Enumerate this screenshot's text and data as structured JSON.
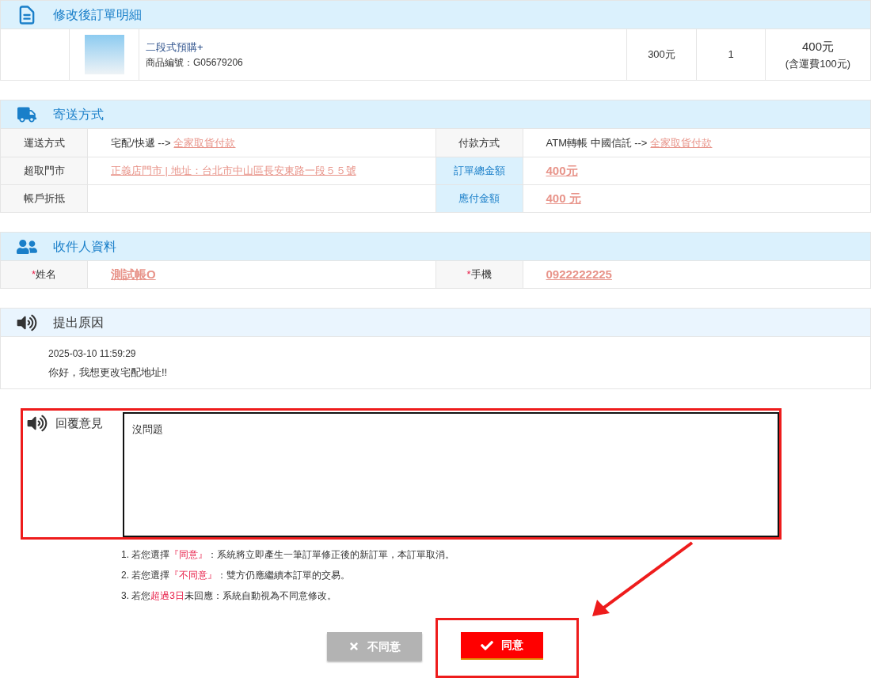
{
  "order_detail": {
    "title": "修改後訂單明細",
    "item": {
      "name": "二段式預購+",
      "code": "商品編號：G05679206",
      "price": "300元",
      "quantity": "1",
      "subtotal": "400元",
      "shipping_note": "(含運費100元)"
    }
  },
  "shipping": {
    "title": "寄送方式",
    "rows": [
      [
        {
          "label": "運送方式",
          "highlighted": false,
          "value": [
            {
              "text": "宅配/快遞 -->",
              "kind": "plain"
            },
            {
              "text": "全家取貨付款",
              "kind": "link"
            }
          ]
        },
        {
          "label": "付款方式",
          "highlighted": false,
          "value": [
            {
              "text": "ATM轉帳 中國信託 -->",
              "kind": "plain"
            },
            {
              "text": "全家取貨付款",
              "kind": "link"
            }
          ]
        }
      ],
      [
        {
          "label": "超取門市",
          "highlighted": false,
          "value": [
            {
              "text": "正義店門市 | 地址：台北市中山區長安東路一段５５號",
              "kind": "link"
            }
          ]
        },
        {
          "label": "訂單總金額",
          "highlighted": true,
          "value": [
            {
              "text": "400元",
              "kind": "amount"
            }
          ]
        }
      ],
      [
        {
          "label": "帳戶折抵",
          "highlighted": false
        },
        {
          "label": "應付金額",
          "highlighted": true,
          "value": [
            {
              "text": "400 元",
              "kind": "amount"
            }
          ]
        }
      ]
    ]
  },
  "recipient": {
    "title": "收件人資料",
    "fields": [
      {
        "required_mark": "*",
        "label": "姓名",
        "value": "測試帳O"
      },
      {
        "required_mark": "*",
        "label": "手機",
        "value": "0922222225"
      }
    ]
  },
  "reason": {
    "title": "提出原因",
    "timestamp": "2025-03-10 11:59:29",
    "message": "你好，我想更改宅配地址!!"
  },
  "reply": {
    "label": "回覆意見",
    "value": "沒問題"
  },
  "notes": [
    [
      {
        "text": "1. 若您選擇",
        "highlight": false
      },
      {
        "text": "『同意』",
        "highlight": true
      },
      {
        "text": "：系統將立即產生一筆訂單修正後的新訂單，本訂單取消。",
        "highlight": false
      }
    ],
    [
      {
        "text": "2. 若您選擇",
        "highlight": false
      },
      {
        "text": "『不同意』",
        "highlight": true
      },
      {
        "text": "：雙方仍應繼續本訂單的交易。",
        "highlight": false
      }
    ],
    [
      {
        "text": "3. 若您",
        "highlight": false
      },
      {
        "text": "超過3日",
        "highlight": true
      },
      {
        "text": "未回應：系統自動視為不同意修改。",
        "highlight": false
      }
    ]
  ],
  "buttons": [
    {
      "label": "不同意",
      "kind": "disagree"
    },
    {
      "label": "同意",
      "kind": "agree"
    }
  ]
}
